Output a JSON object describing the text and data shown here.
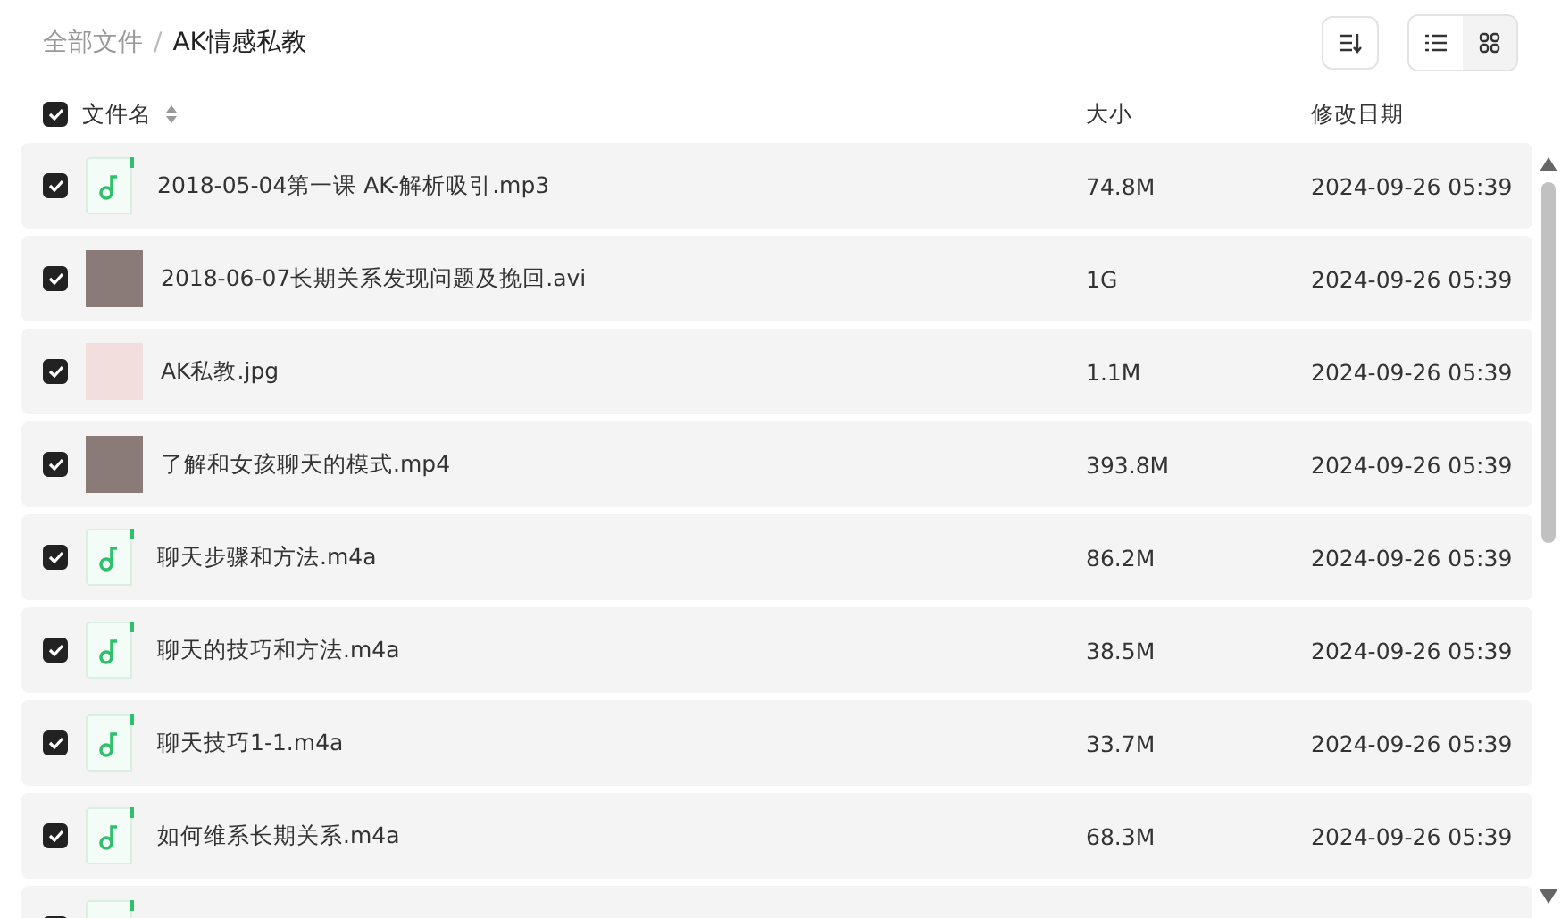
{
  "breadcrumb_separator": "/",
  "breadcrumb": [
    {
      "label": "全部文件",
      "selected": false
    },
    {
      "label": "AK情感私教",
      "selected": true
    }
  ],
  "view_modes": [
    {
      "kind": "list",
      "selected": true
    },
    {
      "kind": "grid",
      "selected": false
    }
  ],
  "table": {
    "all_checked": true,
    "columns": [
      "文件名",
      "大小",
      "修改日期"
    ],
    "rows": [
      {
        "kind": "audio",
        "checked": true,
        "name": "2018-05-04第一课 AK-解析吸引.mp3",
        "size": "74.8M",
        "date": "2024-09-26 05:39"
      },
      {
        "kind": "video",
        "checked": true,
        "name": "2018-06-07长期关系发现问题及挽回.avi",
        "size": "1G",
        "date": "2024-09-26 05:39"
      },
      {
        "kind": "image",
        "checked": true,
        "name": "AK私教.jpg",
        "size": "1.1M",
        "date": "2024-09-26 05:39"
      },
      {
        "kind": "video",
        "checked": true,
        "name": "了解和女孩聊天的模式.mp4",
        "size": "393.8M",
        "date": "2024-09-26 05:39"
      },
      {
        "kind": "audio",
        "checked": true,
        "name": "聊天步骤和方法.m4a",
        "size": "86.2M",
        "date": "2024-09-26 05:39"
      },
      {
        "kind": "audio",
        "checked": true,
        "name": "聊天的技巧和方法.m4a",
        "size": "38.5M",
        "date": "2024-09-26 05:39"
      },
      {
        "kind": "audio",
        "checked": true,
        "name": "聊天技巧1-1.m4a",
        "size": "33.7M",
        "date": "2024-09-26 05:39"
      },
      {
        "kind": "audio",
        "checked": true,
        "name": "如何维系长期关系.m4a",
        "size": "68.3M",
        "date": "2024-09-26 05:39"
      },
      {
        "kind": "audio",
        "checked": true
      }
    ]
  }
}
